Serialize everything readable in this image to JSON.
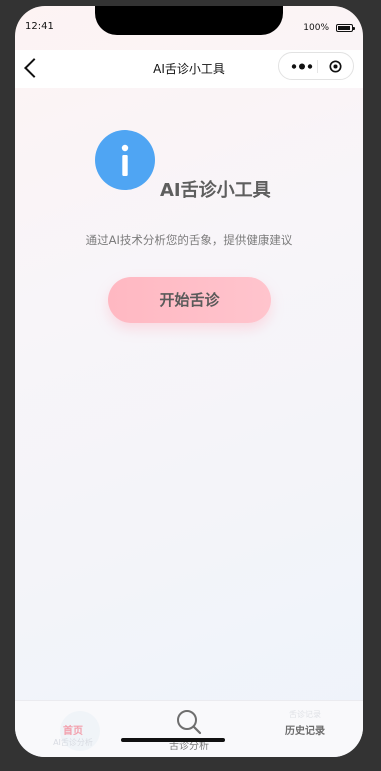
{
  "status_bar": {
    "time": "12:41",
    "battery": "100%"
  },
  "navbar": {
    "title": "AI舌诊小工具"
  },
  "hero": {
    "icon_glyph": "i",
    "title": "AI舌诊小工具",
    "subtitle": "通过AI技术分析您的舌象，提供健康建议"
  },
  "start_button": {
    "label": "开始舌诊"
  },
  "tabbar": {
    "home": {
      "label": "首页",
      "secondary": "AI舌诊分析"
    },
    "diagnose": {
      "label": "舌诊分析"
    },
    "history": {
      "label": "历史记录",
      "secondary": "舌诊记录"
    }
  },
  "colors": {
    "accent_pink": "#ffbcc5",
    "hero_blue": "#4fa5f3",
    "active_tab": "#f2a0ad"
  }
}
